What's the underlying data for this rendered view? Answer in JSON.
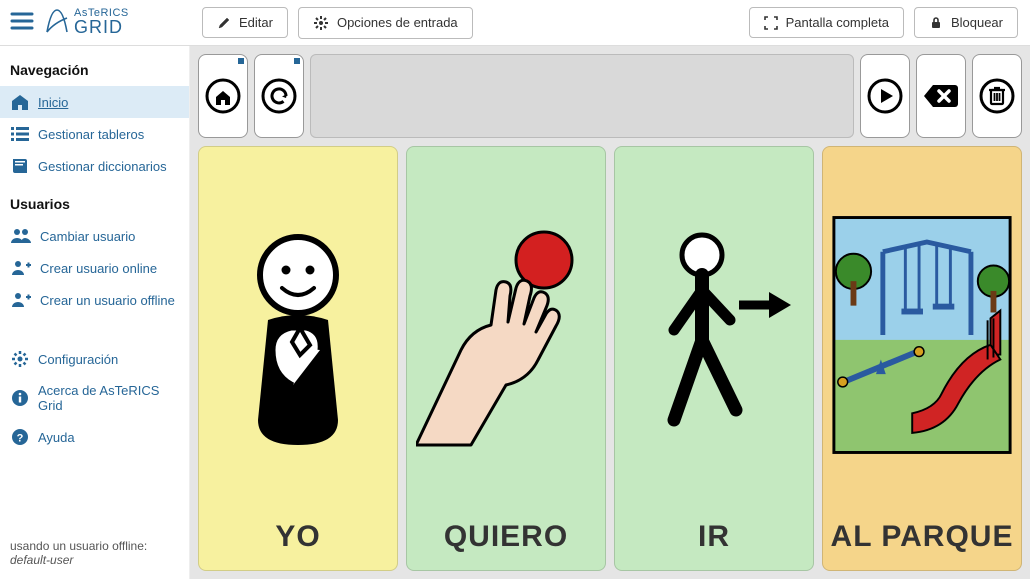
{
  "app": {
    "name1": "AsTeRICS",
    "name2": "GRID"
  },
  "toolbar": {
    "edit": "Editar",
    "input_options": "Opciones de entrada",
    "fullscreen": "Pantalla completa",
    "lock": "Bloquear"
  },
  "sidebar": {
    "nav_heading": "Navegación",
    "users_heading": "Usuarios",
    "items_nav": [
      {
        "label": "Inicio",
        "icon": "home",
        "active": true
      },
      {
        "label": "Gestionar tableros",
        "icon": "list"
      },
      {
        "label": "Gestionar diccionarios",
        "icon": "book"
      }
    ],
    "items_users": [
      {
        "label": "Cambiar usuario",
        "icon": "users"
      },
      {
        "label": "Crear usuario online",
        "icon": "user-plus"
      },
      {
        "label": "Crear un usuario offline",
        "icon": "user-plus"
      }
    ],
    "items_misc": [
      {
        "label": "Configuración",
        "icon": "gear"
      },
      {
        "label": "Acerca de AsTeRICS Grid",
        "icon": "info"
      },
      {
        "label": "Ayuda",
        "icon": "question"
      }
    ],
    "footer_prefix": "usando un usuario offline: ",
    "footer_user": "default-user"
  },
  "actionbar": {
    "home": "home",
    "undo": "undo",
    "play": "play",
    "delete_word": "delete-word",
    "trash": "trash"
  },
  "cards": [
    {
      "label": "YO",
      "color": "yellow",
      "icon": "person-self"
    },
    {
      "label": "QUIERO",
      "color": "green",
      "icon": "hand-ball"
    },
    {
      "label": "IR",
      "color": "green",
      "icon": "walk-arrow"
    },
    {
      "label": "AL PARQUE",
      "color": "orange",
      "icon": "park"
    }
  ]
}
